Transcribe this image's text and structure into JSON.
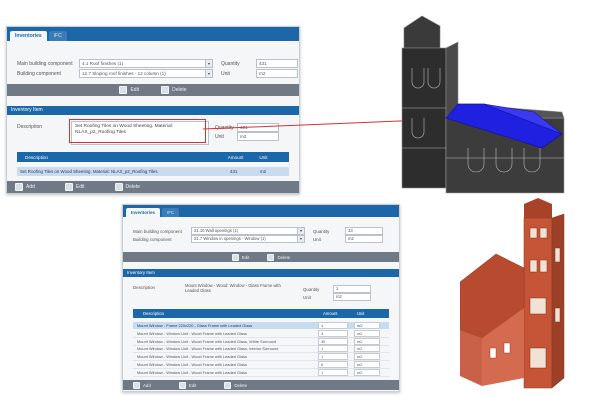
{
  "window1": {
    "tabs": [
      "Inventories",
      "IFC"
    ],
    "main_component_label": "Main building component",
    "main_component_value": "4.1 Roof finishes (1)",
    "building_component_label": "Building component",
    "building_component_value": "12.7 Sloping roof finishes - 12 column (1)",
    "quantity_label": "Quantity",
    "quantity_value": "431",
    "unit_label": "Unit",
    "unit_value": "m2",
    "edit_label": "Edit",
    "delete_label": "Delete",
    "inventory_header": "Inventory Item",
    "description_label": "Description",
    "description_value": "Set Roofing Tiles on Wood Sheeting. Material: NLAX_p2_Roofing Tiles",
    "inv_quantity_label": "Quantity",
    "inv_quantity_value": "431",
    "inv_unit_label": "Unit",
    "inv_unit_value": "m2",
    "columns": [
      "Description",
      "Amount",
      "Unit"
    ],
    "rows": [
      {
        "description": "Set Roofing Tiles on Wood Sheeting. Material: NLAX_p2_Roofing Tiles",
        "amount": "431",
        "unit": "m2"
      }
    ],
    "footer": [
      "Add",
      "Edit",
      "Delete"
    ]
  },
  "window2": {
    "tabs": [
      "Inventories",
      "IFC"
    ],
    "main_component_label": "Main building component",
    "main_component_value": "21.10 Wall openings (1)",
    "building_component_label": "Building component",
    "building_component_value": "21.7 Window in openings - Window (1)",
    "quantity_label": "Quantity",
    "quantity_value": "33",
    "unit_label": "Unit",
    "unit_value": "m2",
    "edit_label": "Edit",
    "delete_label": "Delete",
    "inventory_header": "Inventory Item",
    "description_label": "Description",
    "description_value": "Mount Window - Wood: Window - Glass Frame with Leaded Glass",
    "inv_quantity_label": "Quantity",
    "inv_quantity_value": "1",
    "inv_unit_label": "Unit",
    "inv_unit_value": "m2",
    "columns": [
      "Description",
      "Amount",
      "Unit"
    ],
    "rows": [
      {
        "description": "Mount Window - Frame 220x220 - Glass Frame with Leaded Glass",
        "amount": "1",
        "unit": "m2"
      },
      {
        "description": "Mount Window - Window Unit - Wood Frame with Leaded Glass",
        "amount": "3",
        "unit": "m2"
      },
      {
        "description": "Mount Window - Window Unit - Wood Frame with Leaded Glass, White Surround",
        "amount": "35",
        "unit": "m2"
      },
      {
        "description": "Mount Window - Window Unit - Wood Frame with Leaded Glass, Interior Surround",
        "amount": "1",
        "unit": "m2"
      },
      {
        "description": "Mount Window - Window Unit - Wood Frame with Leaded Glass",
        "amount": "1",
        "unit": "m2"
      },
      {
        "description": "Mount Window - Window Unit - Wood Frame with Leaded Glass",
        "amount": "6",
        "unit": "m2"
      },
      {
        "description": "Mount Window - Window Unit - Wood Frame with Leaded Glass",
        "amount": "1",
        "unit": "m2"
      }
    ],
    "footer": [
      "Add",
      "Edit",
      "Delete"
    ]
  },
  "colors": {
    "header_blue": "#1b67a8",
    "toolbar_gray": "#6f7a86",
    "highlight_red": "#d93030",
    "roof_blue": "#2020e0",
    "brick": "#c55536"
  }
}
